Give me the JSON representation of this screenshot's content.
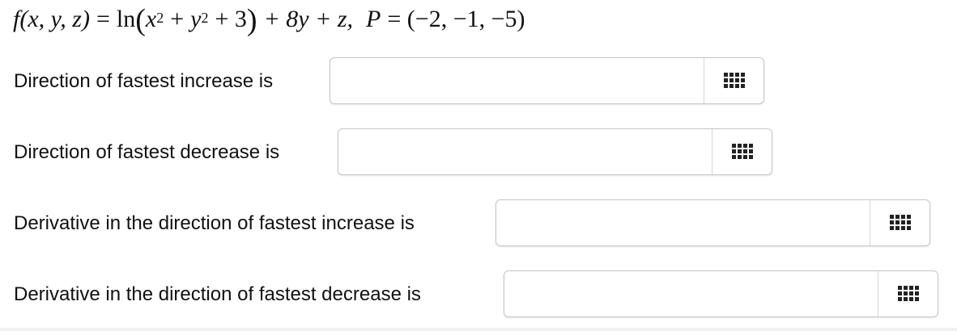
{
  "problem": {
    "f_name": "f",
    "vars": "(x, y, z)",
    "equals": "=",
    "ln": "ln",
    "x": "x",
    "y": "y",
    "exp": "2",
    "plus_three": "+ 3",
    "tail": "+ 8y + z,",
    "point_name": "P",
    "point_value": "= (−2, −1, −5)"
  },
  "questions": [
    {
      "label": "Direction of fastest increase is",
      "value": "",
      "icon": "grid-icon"
    },
    {
      "label": "Direction of fastest decrease is",
      "value": "",
      "icon": "grid-icon"
    },
    {
      "label": "Derivative in the direction of fastest increase is",
      "value": "",
      "icon": "grid-icon"
    },
    {
      "label": "Derivative in the direction of fastest decrease is",
      "value": "",
      "icon": "grid-icon"
    }
  ]
}
